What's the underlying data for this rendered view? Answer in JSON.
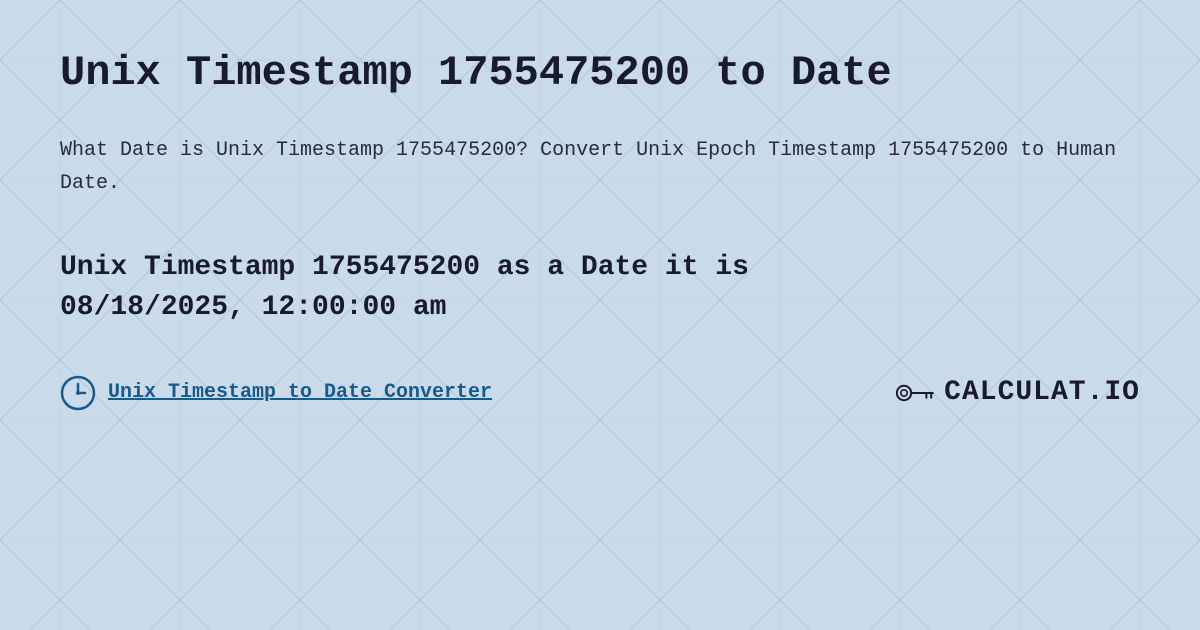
{
  "page": {
    "background_color": "#ccdded",
    "title": "Unix Timestamp 1755475200 to Date",
    "description": "What Date is Unix Timestamp 1755475200? Convert Unix Epoch Timestamp 1755475200 to Human Date.",
    "result_line1": "Unix Timestamp 1755475200 as a Date it is",
    "result_line2": "08/18/2025, 12:00:00 am",
    "footer_link": "Unix Timestamp to Date Converter",
    "logo_text": "CALCULAT.IO"
  }
}
